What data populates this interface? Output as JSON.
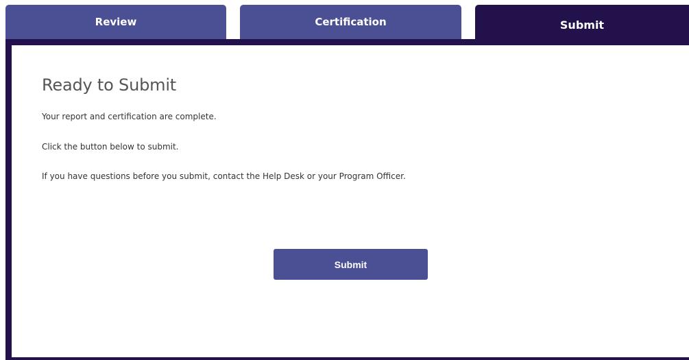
{
  "tabs": [
    {
      "label": "Review",
      "active": false
    },
    {
      "label": "Certification",
      "active": false
    },
    {
      "label": "Submit",
      "active": true
    }
  ],
  "content": {
    "heading": "Ready to Submit",
    "lines": [
      "Your report and certification are complete.",
      "Click the button below to submit.",
      "If you have questions before you submit, contact the Help Desk or your Program Officer."
    ],
    "submit_label": "Submit"
  },
  "colors": {
    "tab_inactive": "#4b4f93",
    "tab_active": "#22114a",
    "button": "#4b4f93",
    "heading_text": "#555555",
    "body_text": "#333333"
  }
}
